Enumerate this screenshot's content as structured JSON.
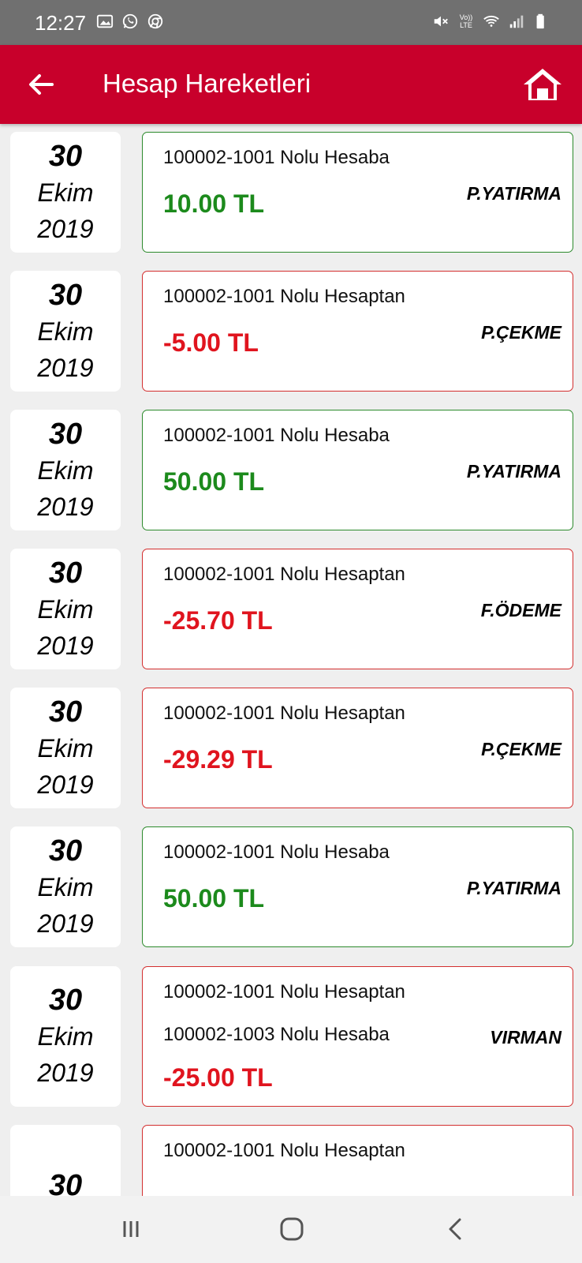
{
  "status_bar": {
    "time": "12:27",
    "left_icons": [
      "image-icon",
      "whatsapp-icon",
      "chrome-icon"
    ],
    "right_icons": [
      "mute-icon",
      "volte-icon",
      "wifi-icon",
      "signal-icon",
      "battery-icon"
    ],
    "volte_text": "Vo)) LTE"
  },
  "app_bar": {
    "title": "Hesap Hareketleri",
    "background": "#c8002b"
  },
  "colors": {
    "deposit": "#1c8a1c",
    "withdrawal": "#e0141e"
  },
  "transactions": [
    {
      "day": "30",
      "month": "Ekim",
      "year": "2019",
      "lines": [
        "100002-1001 Nolu Hesaba"
      ],
      "amount": "10.00 TL",
      "type": "P.YATIRMA",
      "kind": "deposit"
    },
    {
      "day": "30",
      "month": "Ekim",
      "year": "2019",
      "lines": [
        "100002-1001 Nolu Hesaptan"
      ],
      "amount": "-5.00 TL",
      "type": "P.ÇEKME",
      "kind": "withdrawal"
    },
    {
      "day": "30",
      "month": "Ekim",
      "year": "2019",
      "lines": [
        "100002-1001 Nolu Hesaba"
      ],
      "amount": "50.00 TL",
      "type": "P.YATIRMA",
      "kind": "deposit"
    },
    {
      "day": "30",
      "month": "Ekim",
      "year": "2019",
      "lines": [
        "100002-1001 Nolu Hesaptan"
      ],
      "amount": "-25.70 TL",
      "type": "F.ÖDEME",
      "kind": "withdrawal"
    },
    {
      "day": "30",
      "month": "Ekim",
      "year": "2019",
      "lines": [
        "100002-1001 Nolu Hesaptan"
      ],
      "amount": "-29.29 TL",
      "type": "P.ÇEKME",
      "kind": "withdrawal"
    },
    {
      "day": "30",
      "month": "Ekim",
      "year": "2019",
      "lines": [
        "100002-1001 Nolu Hesaba"
      ],
      "amount": "50.00 TL",
      "type": "P.YATIRMA",
      "kind": "deposit"
    },
    {
      "day": "30",
      "month": "Ekim",
      "year": "2019",
      "lines": [
        "100002-1001 Nolu Hesaptan",
        "100002-1003 Nolu Hesaba"
      ],
      "amount": "-25.00 TL",
      "type": "VIRMAN",
      "kind": "withdrawal"
    },
    {
      "day": "30",
      "month": "",
      "year": "",
      "lines": [
        "100002-1001 Nolu Hesaptan"
      ],
      "amount": "",
      "type": "",
      "kind": "withdrawal"
    }
  ],
  "nav_bar": {
    "buttons": [
      "recents-icon",
      "home-circle-icon",
      "back-chevron-icon"
    ]
  }
}
